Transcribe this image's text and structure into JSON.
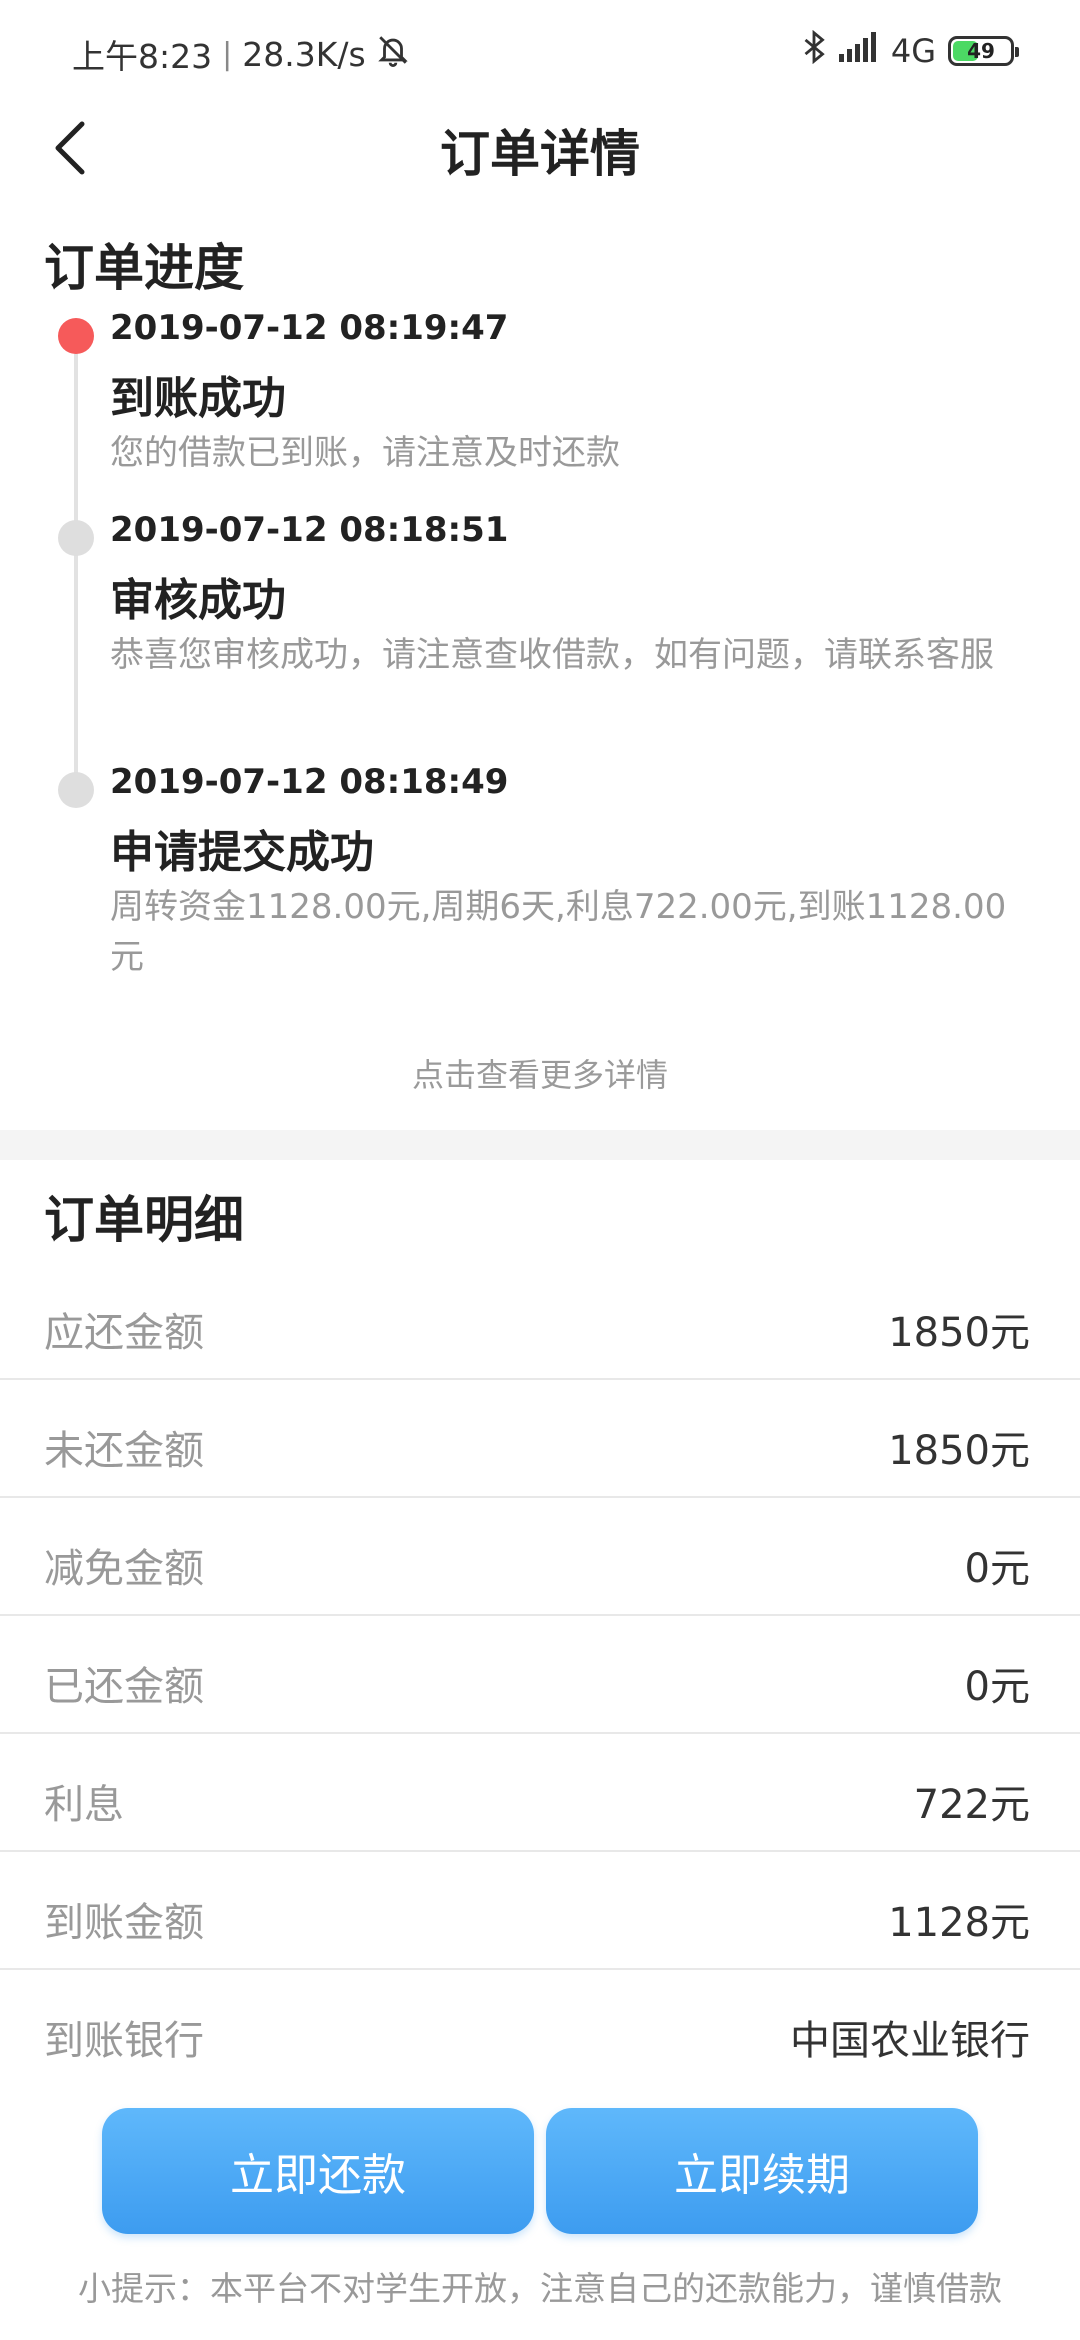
{
  "status_bar": {
    "time": "上午8:23",
    "network_speed": "28.3K/s",
    "network_type": "4G",
    "battery": "49",
    "battery_level_percent": 49
  },
  "nav": {
    "title": "订单详情"
  },
  "progress": {
    "title": "订单进度",
    "items": [
      {
        "time": "2019-07-12 08:19:47",
        "status": "到账成功",
        "desc": "您的借款已到账，请注意及时还款",
        "active": true
      },
      {
        "time": "2019-07-12 08:18:51",
        "status": "审核成功",
        "desc": "恭喜您审核成功，请注意查收借款，如有问题，请联系客服",
        "active": false
      },
      {
        "time": "2019-07-12 08:18:49",
        "status": "申请提交成功",
        "desc": "周转资金1128.00元,周期6天,利息722.00元,到账1128.00元",
        "active": false
      }
    ],
    "more_link": "点击查看更多详情"
  },
  "details": {
    "title": "订单明细",
    "rows": [
      {
        "label": "应还金额",
        "value": "1850元"
      },
      {
        "label": "未还金额",
        "value": "1850元"
      },
      {
        "label": "减免金额",
        "value": "0元"
      },
      {
        "label": "已还金额",
        "value": "0元"
      },
      {
        "label": "利息",
        "value": "722元"
      },
      {
        "label": "到账金额",
        "value": "1128元"
      },
      {
        "label": "到账银行",
        "value": "中国农业银行"
      }
    ]
  },
  "actions": {
    "repay_label": "立即还款",
    "renew_label": "立即续期"
  },
  "tip": "小提示：本平台不对学生开放，注意自己的还款能力，谨慎借款",
  "colors": {
    "accent_blue": "#3d9cf0",
    "active_dot": "#f65a5a",
    "muted_text": "#999999"
  }
}
